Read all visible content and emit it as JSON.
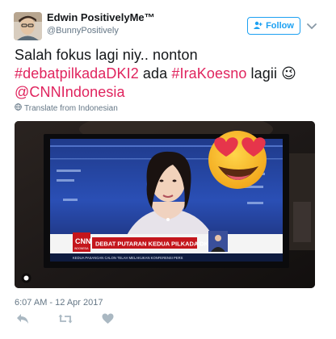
{
  "user": {
    "display_name": "Edwin PositivelyMe™",
    "handle": "@BunnyPositively"
  },
  "follow_button": {
    "label": "Follow",
    "icon": "add-user-icon"
  },
  "menu": {
    "icon": "chevron-down-icon"
  },
  "tweet": {
    "segments": [
      {
        "text": "Salah fokus lagi niy.. nonton ",
        "kind": "text"
      },
      {
        "text": "#debatpilkadaDKI2",
        "kind": "hashtag"
      },
      {
        "text": " ada ",
        "kind": "text"
      },
      {
        "text": "#IraKoesno",
        "kind": "hashtag"
      },
      {
        "text": " lagii ",
        "kind": "text"
      },
      {
        "text": "😉",
        "kind": "emoji"
      },
      {
        "text": "@CNNIndonesia",
        "kind": "mention"
      }
    ]
  },
  "translate": {
    "label": "Translate from Indonesian",
    "icon": "globe-icon"
  },
  "media": {
    "ticker_headline": "DEBAT PUTARAN KEDUA PILKADA DKI",
    "ticker_sub": "KEDUA PASANGAN CALON TELAH MELAKUKAN KONFERENSI PERS",
    "logo": "CNN",
    "logo_sub": "INDONESIA",
    "gif_icon": "gif-badge-icon",
    "overlay": "heart-eyes-emoji"
  },
  "timestamp": "6:07 AM - 12 Apr 2017",
  "actions": [
    {
      "name": "reply",
      "icon": "reply-icon"
    },
    {
      "name": "retweet",
      "icon": "retweet-icon"
    },
    {
      "name": "like",
      "icon": "heart-icon"
    }
  ],
  "colors": {
    "link": "#e0245e",
    "accent": "#1da1f2",
    "secondary": "#657786",
    "text": "#14171a"
  }
}
